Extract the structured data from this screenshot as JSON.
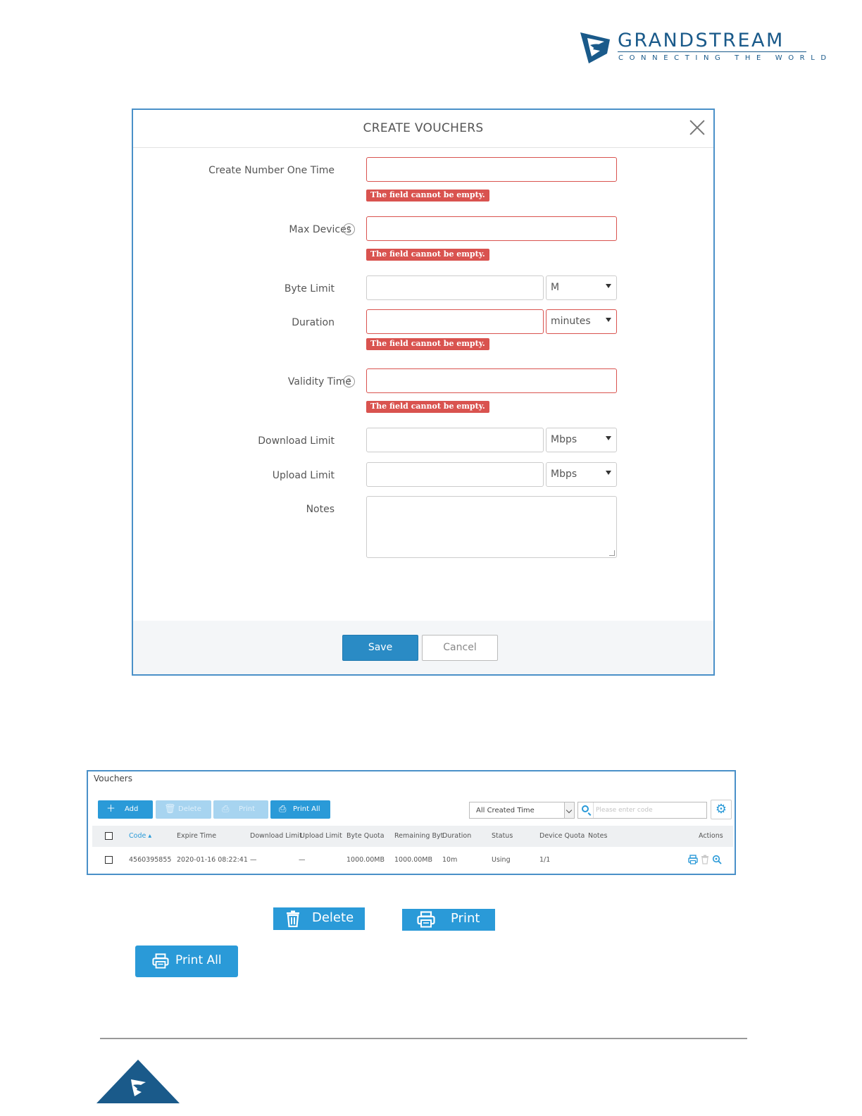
{
  "brand": {
    "name": "GRANDSTREAM",
    "tagline": "CONNECTING THE WORLD",
    "color": "#1a5a8a"
  },
  "modal": {
    "title": "CREATE VOUCHERS",
    "close_icon": "close-icon",
    "fields": {
      "create_number": {
        "label": "Create Number One Time",
        "value": "",
        "error": "The field cannot be empty."
      },
      "max_devices": {
        "label": "Max Devices",
        "value": "",
        "error": "The field cannot be empty."
      },
      "byte_limit": {
        "label": "Byte Limit",
        "value": "",
        "unit": "M"
      },
      "duration": {
        "label": "Duration",
        "value": "",
        "unit": "minutes",
        "error": "The field cannot be empty."
      },
      "validity_time": {
        "label": "Validity Time",
        "value": "",
        "error": "The field cannot be empty."
      },
      "download_limit": {
        "label": "Download Limit",
        "value": "",
        "unit": "Mbps"
      },
      "upload_limit": {
        "label": "Upload Limit",
        "value": "",
        "unit": "Mbps"
      },
      "notes": {
        "label": "Notes",
        "value": ""
      }
    },
    "help_glyph": "?",
    "save_label": "Save",
    "cancel_label": "Cancel"
  },
  "vouchers": {
    "title": "Vouchers",
    "toolbar": {
      "add": "Add",
      "delete": "Delete",
      "print": "Print",
      "print_all": "Print All"
    },
    "filter_value": "All Created Time",
    "search_placeholder": "Please enter code",
    "columns": {
      "code": "Code",
      "expire_time": "Expire Time",
      "download_limit": "Download Limit",
      "upload_limit": "Upload Limit",
      "byte_quota": "Byte Quota",
      "remaining_byte": "Remaining Byte",
      "duration": "Duration",
      "status": "Status",
      "device_quota": "Device Quota",
      "notes": "Notes",
      "actions": "Actions"
    },
    "rows": [
      {
        "code": "4560395855",
        "expire_time": "2020-01-16 08:22:41",
        "download_limit": "—",
        "upload_limit": "—",
        "byte_quota": "1000.00MB",
        "remaining_byte": "1000.00MB",
        "duration": "10m",
        "status": "Using",
        "device_quota": "1/1",
        "notes": ""
      }
    ]
  },
  "legend_buttons": {
    "delete": "Delete",
    "print": "Print",
    "print_all": "Print All"
  },
  "colors": {
    "accent": "#2a9ad8",
    "error": "#d9534f",
    "save": "#2a8bc5",
    "frame": "#4a90c8"
  }
}
